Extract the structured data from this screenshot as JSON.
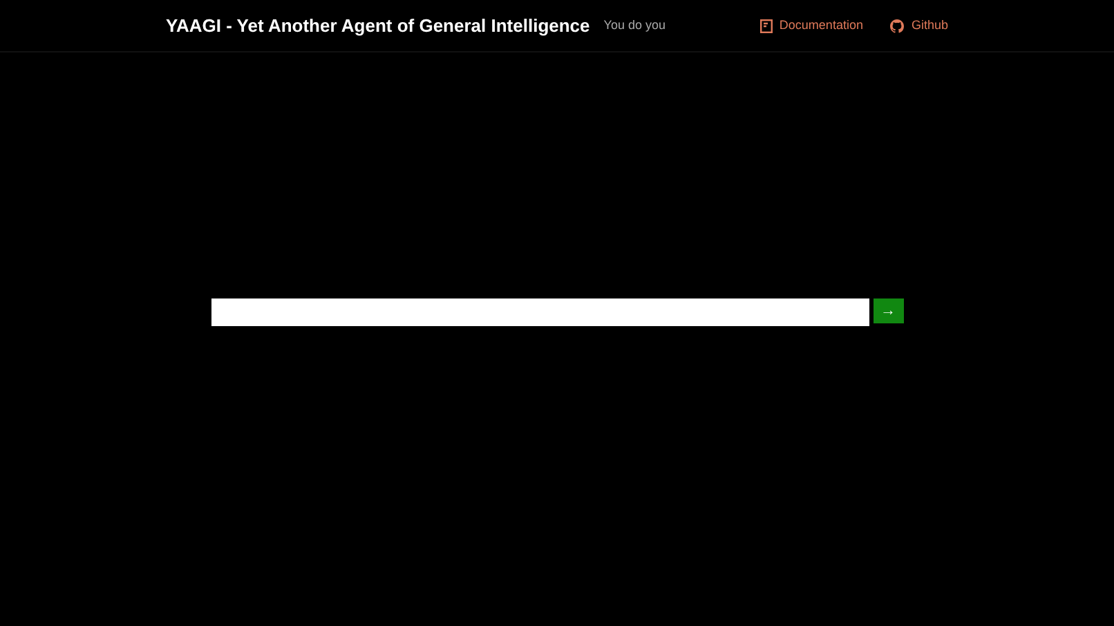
{
  "header": {
    "title": "YAAGI - Yet Another Agent of General Intelligence",
    "tagline": "You do you",
    "links": [
      {
        "kind": "docs",
        "label": "Documentation"
      },
      {
        "kind": "github",
        "label": "Github"
      }
    ]
  },
  "prompt": {
    "submit": "→"
  }
}
